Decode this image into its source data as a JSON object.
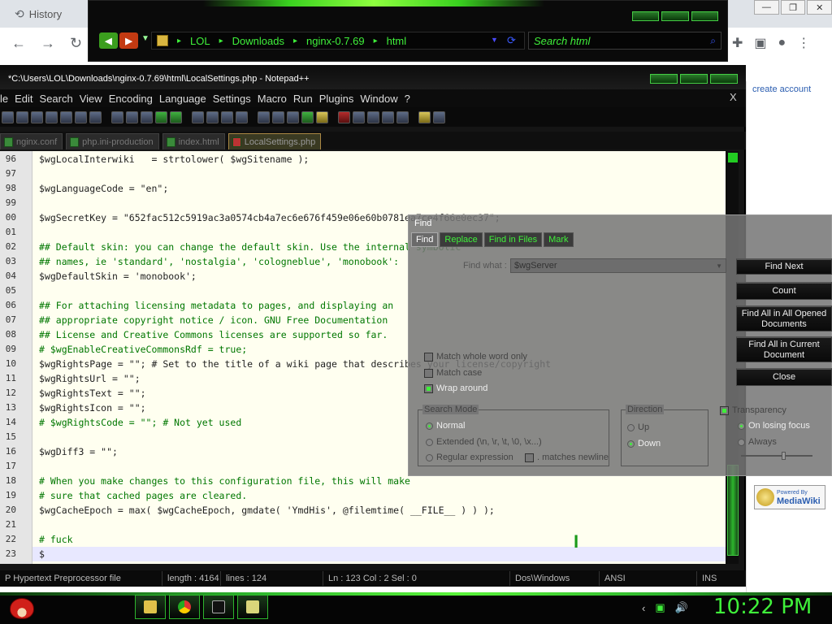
{
  "chrome": {
    "history_tab": "History",
    "create_account": "create account",
    "mediawiki_badge": {
      "top": "Powered By",
      "name": "MediaWiki"
    }
  },
  "explorer": {
    "breadcrumbs": [
      "LOL",
      "Downloads",
      "nginx-0.7.69",
      "html"
    ],
    "search_placeholder": "Search html"
  },
  "npp": {
    "title": "*C:\\Users\\LOL\\Downloads\\nginx-0.7.69\\html\\LocalSettings.php - Notepad++",
    "menu": [
      "le",
      "Edit",
      "Search",
      "View",
      "Encoding",
      "Language",
      "Settings",
      "Macro",
      "Run",
      "Plugins",
      "Window",
      "?"
    ],
    "close_x": "X",
    "tabs": [
      {
        "label": "nginx.conf",
        "active": false
      },
      {
        "label": "php.ini-production",
        "active": false
      },
      {
        "label": "index.html",
        "active": false
      },
      {
        "label": "LocalSettings.php",
        "active": true
      }
    ],
    "lines": [
      {
        "n": "96",
        "text": "$wgLocalInterwiki   = strtolower( $wgSitename );"
      },
      {
        "n": "97",
        "text": ""
      },
      {
        "n": "98",
        "text": "$wgLanguageCode = \"en\";"
      },
      {
        "n": "99",
        "text": ""
      },
      {
        "n": "00",
        "text": "$wgSecretKey = \"652fac512c5919ac3a0574cb4a7ec6e676f459e06e60b0781ea7ce4f66e0ec37\";"
      },
      {
        "n": "01",
        "text": ""
      },
      {
        "n": "02",
        "text": "## Default skin: you can change the default skin. Use the internal symbolic"
      },
      {
        "n": "03",
        "text": "## names, ie 'standard', 'nostalgia', 'cologneblue', 'monobook':"
      },
      {
        "n": "04",
        "text": "$wgDefaultSkin = 'monobook';"
      },
      {
        "n": "05",
        "text": ""
      },
      {
        "n": "06",
        "text": "## For attaching licensing metadata to pages, and displaying an"
      },
      {
        "n": "07",
        "text": "## appropriate copyright notice / icon. GNU Free Documentation"
      },
      {
        "n": "08",
        "text": "## License and Creative Commons licenses are supported so far."
      },
      {
        "n": "09",
        "text": "# $wgEnableCreativeCommonsRdf = true;"
      },
      {
        "n": "10",
        "text": "$wgRightsPage = \"\"; # Set to the title of a wiki page that describes your license/copyright"
      },
      {
        "n": "11",
        "text": "$wgRightsUrl = \"\";"
      },
      {
        "n": "12",
        "text": "$wgRightsText = \"\";"
      },
      {
        "n": "13",
        "text": "$wgRightsIcon = \"\";"
      },
      {
        "n": "14",
        "text": "# $wgRightsCode = \"\"; # Not yet used"
      },
      {
        "n": "15",
        "text": ""
      },
      {
        "n": "16",
        "text": "$wgDiff3 = \"\";"
      },
      {
        "n": "17",
        "text": ""
      },
      {
        "n": "18",
        "text": "# When you make changes to this configuration file, this will make"
      },
      {
        "n": "19",
        "text": "# sure that cached pages are cleared."
      },
      {
        "n": "20",
        "text": "$wgCacheEpoch = max( $wgCacheEpoch, gmdate( 'YmdHis', @filemtime( __FILE__ ) ) );"
      },
      {
        "n": "21",
        "text": ""
      },
      {
        "n": "22",
        "text": "# fuck"
      },
      {
        "n": "23",
        "text": "$"
      }
    ],
    "status": {
      "filetype": "P Hypertext Preprocessor file",
      "length": "length : 4164",
      "lines": "lines : 124",
      "pos": "Ln : 123   Col : 2   Sel : 0",
      "eol": "Dos\\Windows",
      "encoding": "ANSI",
      "mode": "INS"
    }
  },
  "find": {
    "title": "Find",
    "tabs": [
      "Find",
      "Replace",
      "Find in Files",
      "Mark"
    ],
    "find_what_label": "Find what :",
    "find_what_value": "$wgServer",
    "buttons": {
      "find_next": "Find Next",
      "count": "Count",
      "find_all_opened": "Find All in All Opened Documents",
      "find_all_current": "Find All in Current Document",
      "close": "Close"
    },
    "options": {
      "whole_word": "Match whole word only",
      "match_case": "Match case",
      "wrap_around": "Wrap around"
    },
    "search_mode": {
      "label": "Search Mode",
      "normal": "Normal",
      "extended": "Extended (\\n, \\r, \\t, \\0, \\x...)",
      "regex": "Regular expression",
      "matches_newline": ". matches newline"
    },
    "direction": {
      "label": "Direction",
      "up": "Up",
      "down": "Down"
    },
    "transparency": {
      "label": "Transparency",
      "on_losing_focus": "On losing focus",
      "always": "Always"
    }
  },
  "taskbar": {
    "clock": "10:22 PM"
  }
}
